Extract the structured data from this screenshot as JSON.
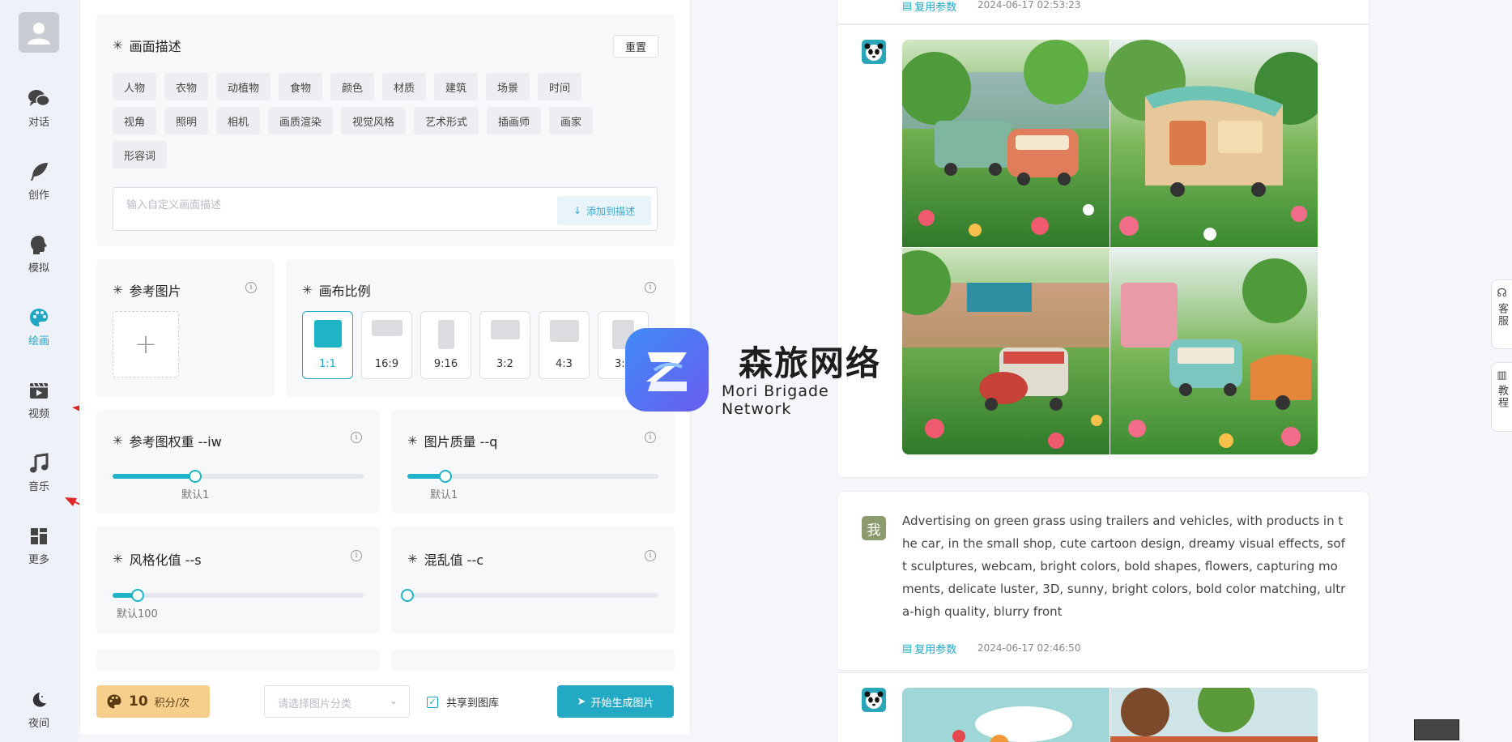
{
  "nav": {
    "items": [
      {
        "label": "对话",
        "icon": "chat-icon"
      },
      {
        "label": "创作",
        "icon": "feather-icon"
      },
      {
        "label": "模拟",
        "icon": "head-icon"
      },
      {
        "label": "绘画",
        "icon": "palette-icon"
      },
      {
        "label": "视频",
        "icon": "video-icon"
      },
      {
        "label": "音乐",
        "icon": "music-icon"
      },
      {
        "label": "更多",
        "icon": "grid-icon"
      }
    ],
    "night_label": "夜间",
    "active": "绘画",
    "accent_color": "#1fa8c3"
  },
  "description": {
    "title": "画面描述",
    "reset_label": "重置",
    "tags": [
      "人物",
      "衣物",
      "动植物",
      "食物",
      "颜色",
      "材质",
      "建筑",
      "场景",
      "时间",
      "视角",
      "照明",
      "相机",
      "画质渲染",
      "视觉风格",
      "艺术形式",
      "插画师",
      "画家",
      "形容词"
    ],
    "input_placeholder": "输入自定义画面描述",
    "add_label": "添加到描述"
  },
  "reference": {
    "title": "参考图片"
  },
  "ratio": {
    "title": "画布比例",
    "options": [
      "1:1",
      "16:9",
      "9:16",
      "3:2",
      "4:3",
      "3:4"
    ],
    "selected": "1:1"
  },
  "sliders": {
    "iw": {
      "title": "参考图权重 --iw",
      "hint": "默认1",
      "value": 0.33
    },
    "q": {
      "title": "图片质量 --q",
      "hint": "默认1",
      "value": 0.15
    },
    "s": {
      "title": "风格化值 --s",
      "hint": "默认100",
      "value": 0.1
    },
    "c": {
      "title": "混乱值 --c",
      "hint": "",
      "value": 0.0
    }
  },
  "bottom": {
    "cost_value": "10",
    "cost_unit": "积分/次",
    "category_placeholder": "请选择图片分类",
    "share_label": "共享到图库",
    "share_checked": true,
    "generate_label": "开始生成图片"
  },
  "chat": {
    "top_reuse": "复用参数",
    "top_time": "2024-06-17 02:53:23",
    "user_avatar_text": "我",
    "prompt": "Advertising on green grass using trailers and vehicles, with products in the car, in the small shop, cute cartoon design, dreamy visual effects, soft sculptures, webcam, bright colors, bold shapes, flowers, capturing moments, delicate luster, 3D, sunny, bright colors, bold color matching, ultra-high quality, blurry front",
    "reuse_label": "复用参数",
    "timestamp": "2024-06-17 02:46:50"
  },
  "watermark": {
    "cn": "森旅网络",
    "en": "Mori Brigade Network"
  },
  "floating": {
    "service": "客服",
    "tutorial": "教程"
  }
}
